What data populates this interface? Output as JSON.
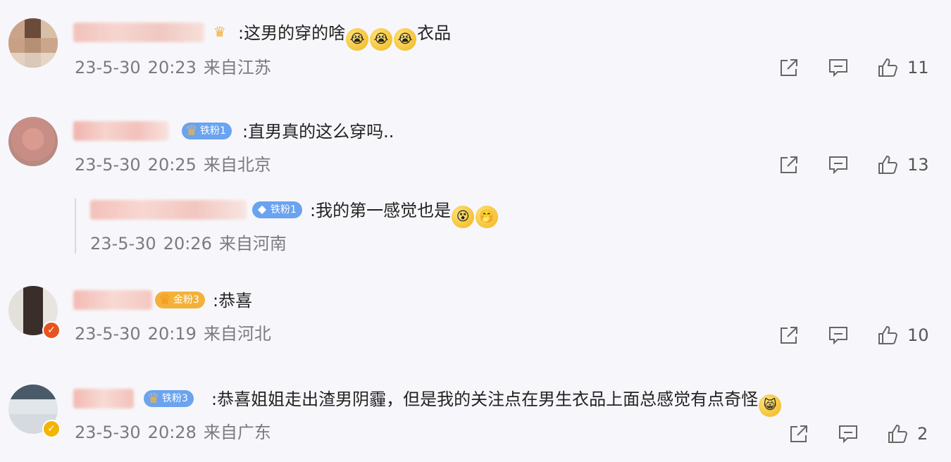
{
  "colors": {
    "badge_blue": "#6aa3ef",
    "badge_gold": "#f3b13a",
    "verify_red": "#e8541e",
    "verify_gold": "#f4b400",
    "meta_gray": "#7a7a80"
  },
  "comments": [
    {
      "text": ":这男的穿的啥",
      "text_suffix": "衣品",
      "emoji_count": 3,
      "date": "23-5-30",
      "time": "20:23",
      "location": "来自江苏",
      "likes": "11",
      "badge": ""
    },
    {
      "text": ":直男真的这么穿吗..",
      "date": "23-5-30",
      "time": "20:25",
      "location": "来自北京",
      "likes": "13",
      "badge": "铁粉1"
    },
    {
      "text": ":我的第一感觉也是",
      "date": "23-5-30",
      "time": "20:26",
      "location": "来自河南",
      "badge": "铁粉1"
    },
    {
      "text": ":恭喜",
      "date": "23-5-30",
      "time": "20:19",
      "location": "来自河北",
      "likes": "10",
      "badge": "金粉3"
    },
    {
      "text": ":恭喜姐姐走出渣男阴霾，但是我的关注点在男生衣品上面总感觉有点奇怪",
      "date": "23-5-30",
      "time": "20:28",
      "location": "来自广东",
      "likes": "2",
      "badge": "铁粉3"
    }
  ],
  "icons": {
    "share": "share-icon",
    "comment": "comment-icon",
    "like": "thumbs-up-icon"
  }
}
